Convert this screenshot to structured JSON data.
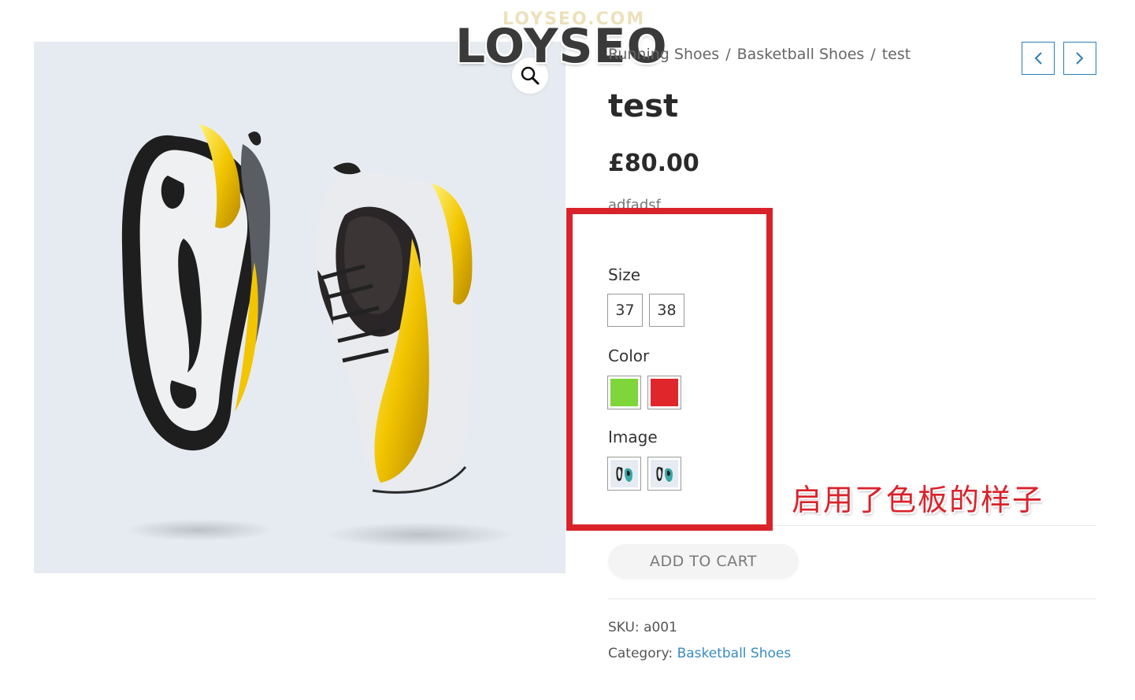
{
  "watermark": {
    "text": "LOYSEO",
    "faint_text": "LOYSEO.COM"
  },
  "breadcrumb": {
    "items": [
      "Running Shoes",
      "Basketball Shoes",
      "test"
    ],
    "separator": "/"
  },
  "navigation": {
    "prev_icon": "chevron-left-icon",
    "next_icon": "chevron-right-icon"
  },
  "product": {
    "title": "test",
    "price": "£80.00",
    "short_description": "adfadsf",
    "zoom_icon": "magnifier-icon"
  },
  "attributes": {
    "size": {
      "label": "Size",
      "options": [
        "37",
        "38"
      ]
    },
    "color": {
      "label": "Color",
      "options": [
        {
          "name": "green",
          "hex": "#7ed63a"
        },
        {
          "name": "red",
          "hex": "#e0262a"
        }
      ]
    },
    "image": {
      "label": "Image",
      "options": [
        "shoe-thumb-1",
        "shoe-thumb-2"
      ]
    }
  },
  "annotation": {
    "text": "启用了色板的样子",
    "box_color": "#d9232b"
  },
  "cart": {
    "button_label": "ADD TO CART"
  },
  "meta": {
    "sku_label": "SKU:",
    "sku_value": "a001",
    "category_label": "Category:",
    "category_value": "Basketball Shoes"
  },
  "colors": {
    "accent": "#2d7fb8",
    "link": "#3a8bbf",
    "image_bg": "#e6ebf2"
  }
}
